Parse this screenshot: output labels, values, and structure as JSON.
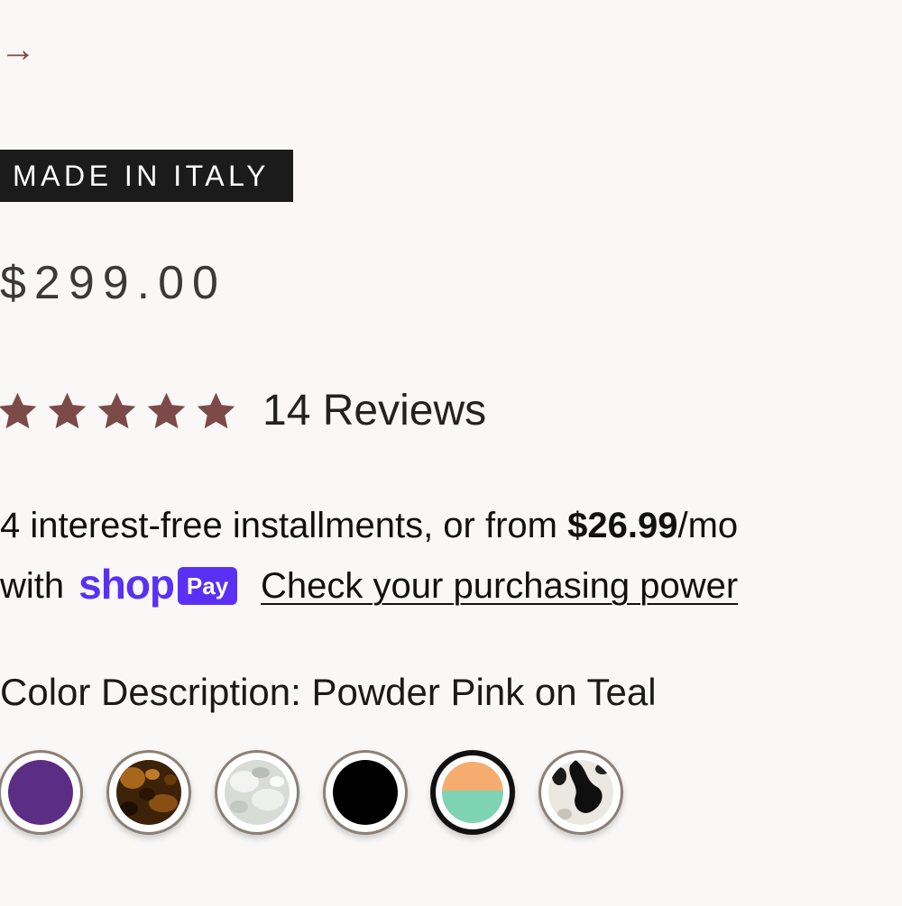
{
  "nav": {
    "arrow_glyph": "→",
    "arrow_icon": "right-arrow-icon"
  },
  "product": {
    "badge": "MADE IN ITALY",
    "price": "$299.00"
  },
  "rating": {
    "stars": 5,
    "star_color": "#7d4a4a",
    "reviews_label": "14 Reviews"
  },
  "installments": {
    "line1_prefix": "4 interest-free installments, or from ",
    "monthly_amount": "$26.99",
    "line1_suffix": "/mo",
    "with_label": "with",
    "shop_word": "shop",
    "pay_label": "Pay",
    "purchasing_power_link": "Check your purchasing power",
    "brand_color": "#5a31f4"
  },
  "color_description": {
    "text": "Color Description: Powder Pink on Teal"
  },
  "swatches": [
    {
      "name": "swatch-purple",
      "color": "#5c2d85",
      "selected": false
    },
    {
      "name": "swatch-tortoise",
      "color": "#4a2a10",
      "selected": false
    },
    {
      "name": "swatch-pearl-white",
      "color": "#dcdedb",
      "selected": false
    },
    {
      "name": "swatch-black",
      "color": "#000000",
      "selected": false
    },
    {
      "name": "swatch-powder-pink-on-teal",
      "color_top": "#f6ac6f",
      "color_bottom": "#7dd3b4",
      "selected": true
    },
    {
      "name": "swatch-black-white-cow",
      "color": "#e9e5df",
      "selected": false
    }
  ]
}
